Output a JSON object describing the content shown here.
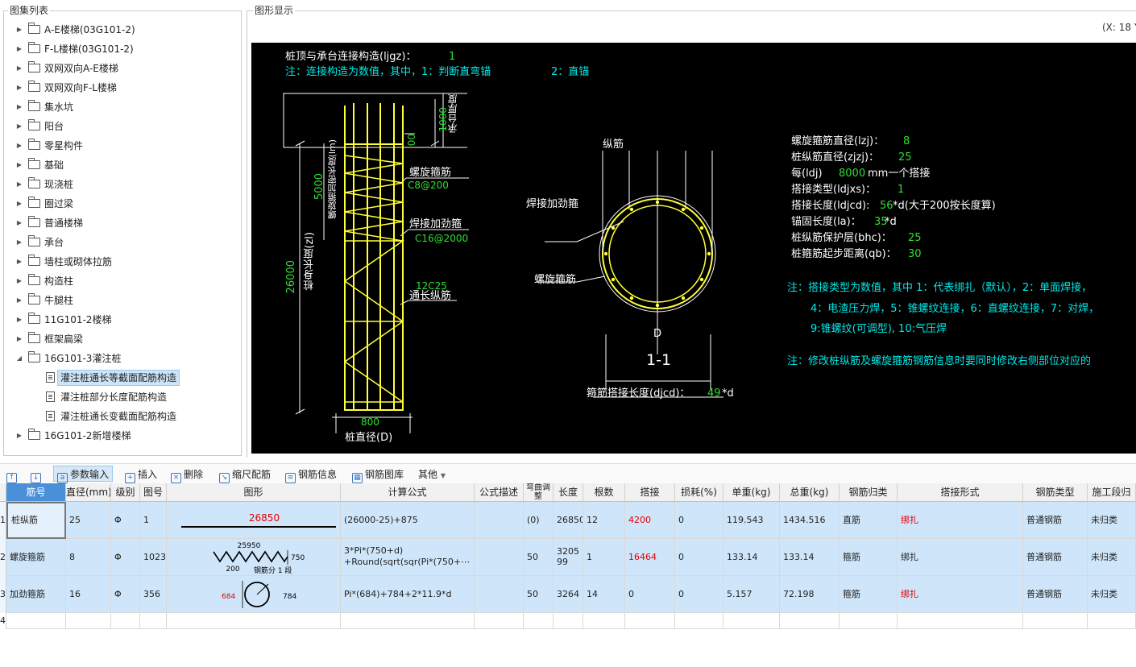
{
  "left_panel": {
    "title": "图集列表",
    "items": [
      {
        "label": "A-E楼梯(03G101-2)",
        "type": "folder",
        "expanded": false
      },
      {
        "label": "F-L楼梯(03G101-2)",
        "type": "folder",
        "expanded": false
      },
      {
        "label": "双网双向A-E楼梯",
        "type": "folder",
        "expanded": false
      },
      {
        "label": "双网双向F-L楼梯",
        "type": "folder",
        "expanded": false
      },
      {
        "label": "集水坑",
        "type": "folder",
        "expanded": false
      },
      {
        "label": "阳台",
        "type": "folder",
        "expanded": false
      },
      {
        "label": "零星构件",
        "type": "folder",
        "expanded": false
      },
      {
        "label": "基础",
        "type": "folder",
        "expanded": false
      },
      {
        "label": "现浇桩",
        "type": "folder",
        "expanded": false
      },
      {
        "label": "圈过梁",
        "type": "folder",
        "expanded": false
      },
      {
        "label": "普通楼梯",
        "type": "folder",
        "expanded": false
      },
      {
        "label": "承台",
        "type": "folder",
        "expanded": false
      },
      {
        "label": "墙柱或砌体拉筋",
        "type": "folder",
        "expanded": false
      },
      {
        "label": "构造柱",
        "type": "folder",
        "expanded": false
      },
      {
        "label": "牛腿柱",
        "type": "folder",
        "expanded": false
      },
      {
        "label": "11G101-2楼梯",
        "type": "folder",
        "expanded": false
      },
      {
        "label": "框架扁梁",
        "type": "folder",
        "expanded": false
      },
      {
        "label": "16G101-3灌注桩",
        "type": "folder",
        "expanded": true
      },
      {
        "label": "灌注桩通长等截面配筋构造",
        "type": "doc",
        "selected": true
      },
      {
        "label": "灌注桩部分长度配筋构造",
        "type": "doc"
      },
      {
        "label": "灌注桩通长变截面配筋构造",
        "type": "doc"
      },
      {
        "label": "16G101-2新增楼梯",
        "type": "folder",
        "expanded": false
      }
    ]
  },
  "graph_panel": {
    "title": "图形显示",
    "coord_readout": "(X: 18 Y"
  },
  "drawing": {
    "line1_label": "桩顶与承台连接构造(ljgz)：",
    "line1_value": "1",
    "line2": "注：连接构造为数值，其中，1：判断直弯锚",
    "line2b": "2：直锚",
    "dim_1000": "1000",
    "label_cap": "承台厚度",
    "dim_top": "00",
    "dim_5000": "5000",
    "label_dense": "螺旋箍加密长度(lm)",
    "dim_26000": "26000",
    "label_body": "桩身长度(zl)",
    "spiral_label": "螺旋箍筋",
    "spiral_spec": "C8@200",
    "weld_label": "焊接加劲箍",
    "weld_spec": "C16@2000",
    "long_spec": "12C25",
    "long_label": "通长纵筋",
    "dim_800": "800",
    "pile_diam": "桩直径(D)",
    "sec_long": "纵筋",
    "sec_weld": "焊接加劲箍",
    "sec_spiral": "螺旋箍筋",
    "sec_d": "D",
    "sec_title": "1-1",
    "lap_label": "箍筋搭接长度(djcd)：",
    "lap_value": "49",
    "lap_unit": "*d",
    "params": [
      {
        "label": "螺旋箍筋直径(lzj)：",
        "value": "8",
        "suffix": ""
      },
      {
        "label": "桩纵筋直径(zjzj)：",
        "value": "25",
        "suffix": ""
      },
      {
        "label": "每(ldj) ",
        "value": "8000",
        "suffix": "mm一个搭接"
      },
      {
        "label": "搭接类型(ldjxs)：",
        "value": "1",
        "suffix": ""
      },
      {
        "label": "搭接长度(ldjcd):",
        "value": "56",
        "suffix": "*d(大于200按长度算)"
      },
      {
        "label": "锚固长度(la)：",
        "value": "35",
        "suffix": "*d"
      },
      {
        "label": "桩纵筋保护层(bhc)：",
        "value": "25",
        "suffix": ""
      },
      {
        "label": "桩箍筋起步距离(qb)：",
        "value": "30",
        "suffix": ""
      }
    ],
    "note1": "注：搭接类型为数值，其中 1：代表绑扎（默认），2：单面焊接，",
    "note2": "4：电渣压力焊，5：锥螺纹连接，6：直螺纹连接，7：对焊，",
    "note3": "9:锥螺纹(可调型), 10:气压焊",
    "note4": "注：修改桩纵筋及螺旋箍筋钢筋信息时要同时修改右侧部位对应的"
  },
  "toolbar": {
    "param_input": "参数输入",
    "insert": "插入",
    "delete": "删除",
    "scale_rebar": "缩尺配筋",
    "rebar_info": "钢筋信息",
    "rebar_lib": "钢筋图库",
    "other": "其他"
  },
  "table": {
    "headers": [
      "筋号",
      "直径(mm)",
      "级别",
      "图号",
      "图形",
      "计算公式",
      "公式描述",
      "弯曲调整",
      "长度",
      "根数",
      "搭接",
      "损耗(%)",
      "单重(kg)",
      "总重(kg)",
      "钢筋归类",
      "搭接形式",
      "钢筋类型",
      "施工段归"
    ],
    "rows": [
      {
        "num": "1",
        "name": "桩纵筋",
        "dia": "25",
        "grade": "Φ",
        "fig": "1",
        "shape_value": "26850",
        "formula": "(26000-25)+875",
        "desc": "",
        "bend": "(0)",
        "length": "26850",
        "count": "12",
        "lap": "4200",
        "loss": "0",
        "unit_w": "119.543",
        "total_w": "1434.516",
        "category": "直筋",
        "lap_type": "绑扎",
        "rebar_type": "普通钢筋",
        "segment": "未归类"
      },
      {
        "num": "2",
        "name": "螺旋箍筋",
        "dia": "8",
        "grade": "Φ",
        "fig": "1023",
        "shape_top": "25950",
        "shape_side": "750",
        "shape_bottom": "200",
        "shape_note": "钢筋分 1 段",
        "formula_l1": "3*Pi*(750+d)",
        "formula_l2": "+Round(sqrt(sqr(Pi*(750+⋯",
        "desc": "",
        "bend": "50",
        "length": "320599",
        "count": "1",
        "lap": "16464",
        "loss": "0",
        "unit_w": "133.14",
        "total_w": "133.14",
        "category": "箍筋",
        "lap_type": "绑扎",
        "rebar_type": "普通钢筋",
        "segment": "未归类"
      },
      {
        "num": "3",
        "name": "加劲箍筋",
        "dia": "16",
        "grade": "Φ",
        "fig": "356",
        "shape_left": "684",
        "shape_right": "784",
        "formula": "Pi*(684)+784+2*11.9*d",
        "desc": "",
        "bend": "50",
        "length": "3264",
        "count": "14",
        "lap": "0",
        "loss": "0",
        "unit_w": "5.157",
        "total_w": "72.198",
        "category": "箍筋",
        "lap_type": "绑扎",
        "rebar_type": "普通钢筋",
        "segment": "未归类"
      },
      {
        "num": "4"
      }
    ]
  }
}
